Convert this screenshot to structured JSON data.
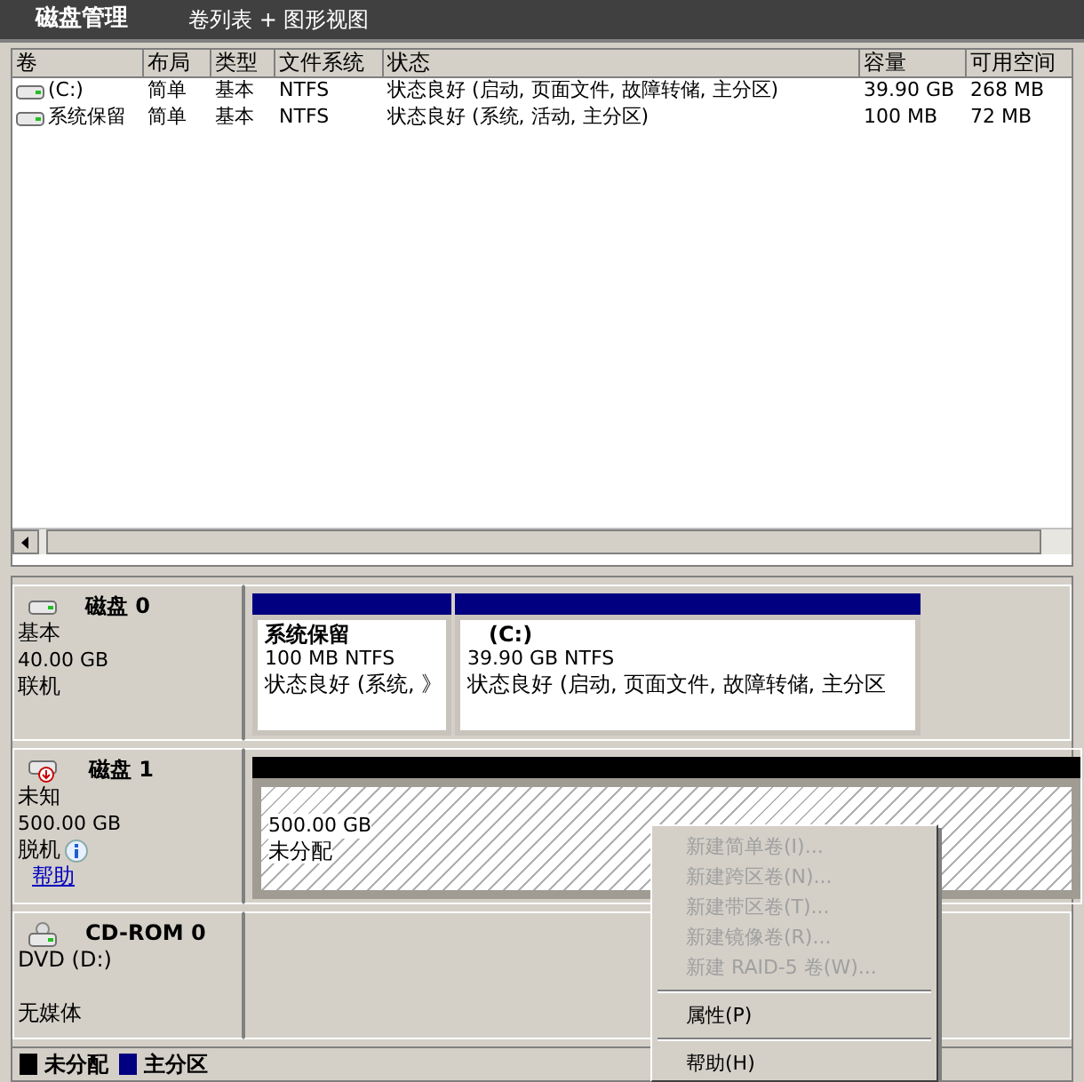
{
  "header": {
    "title": "磁盘管理",
    "view": "卷列表 + 图形视图"
  },
  "table": {
    "columns": [
      "卷",
      "布局",
      "类型",
      "文件系统",
      "状态",
      "容量",
      "可用空间"
    ],
    "rows": [
      {
        "cells": [
          "(C:)",
          "简单",
          "基本",
          "NTFS",
          "状态良好 (启动, 页面文件, 故障转储, 主分区)",
          "39.90 GB",
          "268 MB"
        ]
      },
      {
        "cells": [
          "系统保留",
          "简单",
          "基本",
          "NTFS",
          "状态良好 (系统, 活动, 主分区)",
          "100 MB",
          "72 MB"
        ]
      }
    ]
  },
  "disks": [
    {
      "kind": "disk",
      "name": "磁盘 0",
      "type": "基本",
      "size": "40.00 GB",
      "status": "联机",
      "offline": false,
      "partitions": [
        {
          "kind": "primary",
          "selected": false,
          "name": "系统保留",
          "size": "100 MB NTFS",
          "status": "状态良好 (系统, 》"
        },
        {
          "kind": "primary",
          "selected": false,
          "name": "(C:)",
          "size": "39.90 GB NTFS",
          "status": "状态良好 (启动, 页面文件, 故障转储, 主分区"
        }
      ]
    },
    {
      "kind": "disk",
      "name": "磁盘 1",
      "type": "未知",
      "size": "500.00 GB",
      "status": "脱机",
      "offline": true,
      "help": "帮助",
      "partitions": [
        {
          "kind": "unallocated",
          "selected": true,
          "size": "500.00 GB",
          "status": "未分配"
        }
      ]
    },
    {
      "kind": "cdrom",
      "name": "CD-ROM 0",
      "type": "DVD (D:)",
      "status": "无媒体"
    }
  ],
  "legend": [
    {
      "label": "未分配",
      "color": "#000000"
    },
    {
      "label": "主分区",
      "color": "#000080"
    }
  ],
  "context_menu": {
    "groups": [
      [
        {
          "label": "新建简单卷(I)...",
          "disabled": true
        },
        {
          "label": "新建跨区卷(N)...",
          "disabled": true
        },
        {
          "label": "新建带区卷(T)...",
          "disabled": true
        },
        {
          "label": "新建镜像卷(R)...",
          "disabled": true
        },
        {
          "label": "新建 RAID-5 卷(W)...",
          "disabled": true
        }
      ],
      [
        {
          "label": "属性(P)",
          "disabled": false
        }
      ],
      [
        {
          "label": "帮助(H)",
          "disabled": false
        }
      ]
    ]
  }
}
